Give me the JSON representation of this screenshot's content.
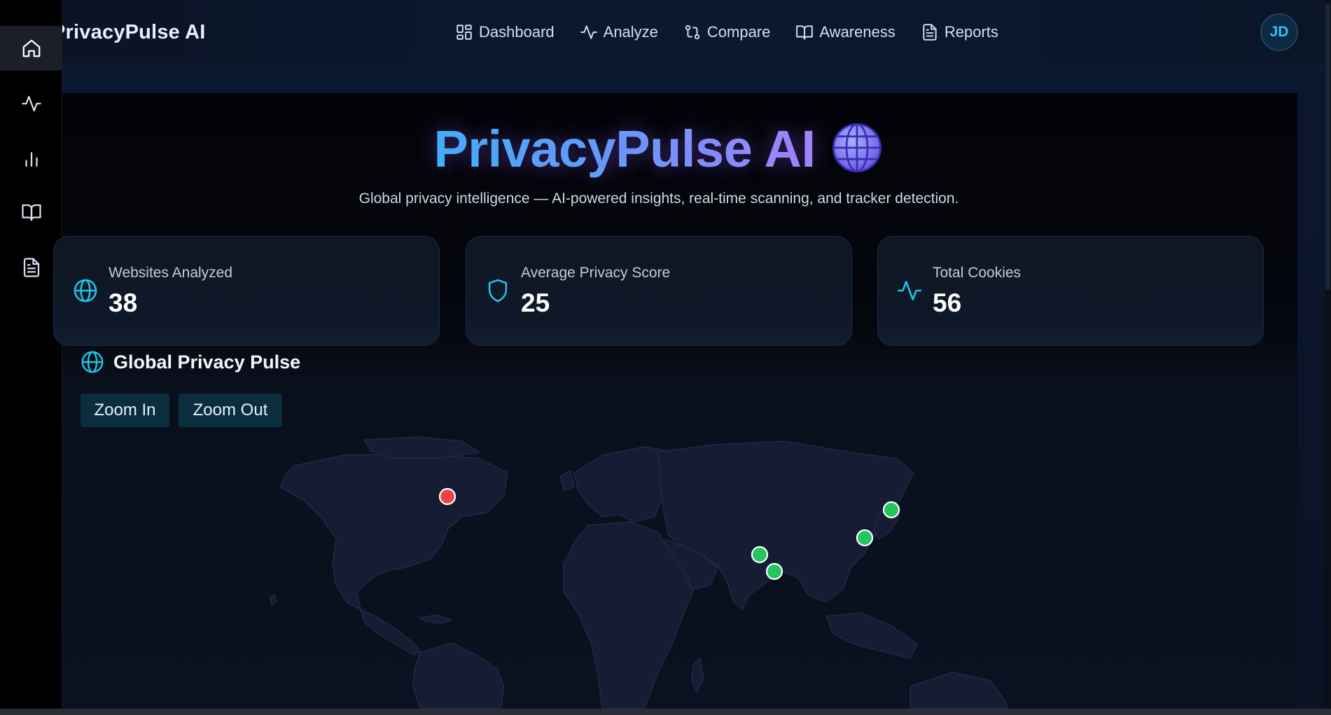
{
  "app": {
    "brand": "PrivacyPulse AI",
    "accent": "#38bdf8",
    "background": "#060a14"
  },
  "nav": {
    "items": [
      {
        "label": "Dashboard",
        "icon": "layout-grid-icon"
      },
      {
        "label": "Analyze",
        "icon": "activity-icon"
      },
      {
        "label": "Compare",
        "icon": "git-compare-icon"
      },
      {
        "label": "Awareness",
        "icon": "book-open-icon"
      },
      {
        "label": "Reports",
        "icon": "file-text-icon"
      }
    ],
    "avatar_initials": "JD"
  },
  "sidebar": {
    "items": [
      {
        "icon": "home-icon",
        "active": true
      },
      {
        "icon": "activity-icon",
        "active": false
      },
      {
        "icon": "bar-chart-icon",
        "active": false
      },
      {
        "icon": "book-open-icon",
        "active": false
      },
      {
        "icon": "file-text-icon",
        "active": false
      }
    ]
  },
  "hero": {
    "title": "PrivacyPulse AI",
    "emoji_icon": "globe-emoji-icon",
    "subtitle": "Global privacy intelligence — AI-powered insights, real-time scanning, and tracker detection."
  },
  "stats": [
    {
      "label": "Websites Analyzed",
      "value": "38",
      "icon": "globe-icon"
    },
    {
      "label": "Average Privacy Score",
      "value": "25",
      "icon": "shield-icon"
    },
    {
      "label": "Total Cookies",
      "value": "56",
      "icon": "activity-icon"
    }
  ],
  "map_section": {
    "title": "Global Privacy Pulse",
    "zoom_in_label": "Zoom In",
    "zoom_out_label": "Zoom Out",
    "status_colors": {
      "low_score": "#ef4444",
      "high_score": "#22c55e"
    }
  }
}
